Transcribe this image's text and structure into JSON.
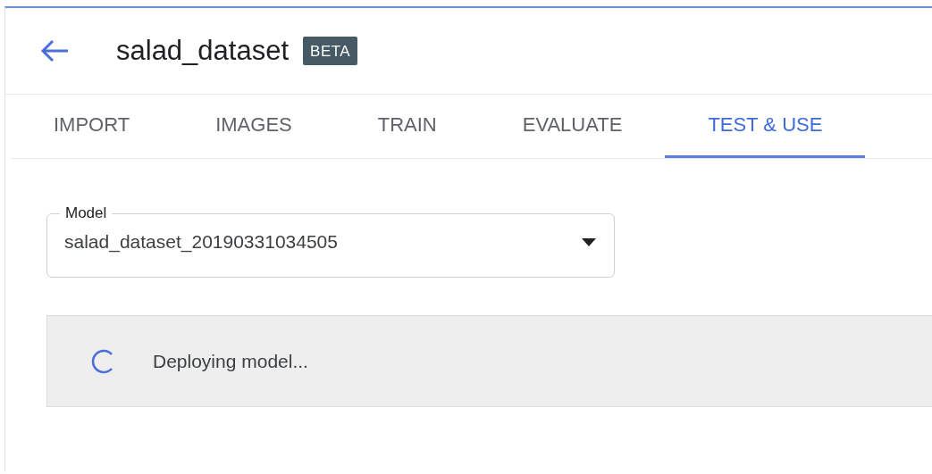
{
  "header": {
    "title": "salad_dataset",
    "badge": "BETA"
  },
  "tabs": [
    {
      "label": "IMPORT",
      "selected": false
    },
    {
      "label": "IMAGES",
      "selected": false
    },
    {
      "label": "TRAIN",
      "selected": false
    },
    {
      "label": "EVALUATE",
      "selected": false
    },
    {
      "label": "TEST & USE",
      "selected": true
    }
  ],
  "model_select": {
    "label": "Model",
    "value": "salad_dataset_20190331034505"
  },
  "status": {
    "message": "Deploying model..."
  }
}
